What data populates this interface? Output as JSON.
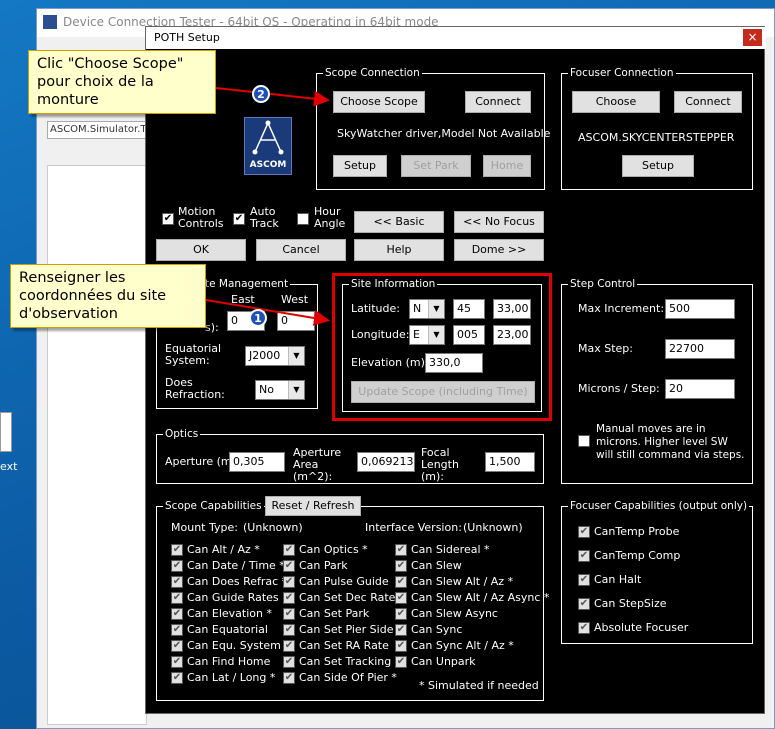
{
  "bg": {
    "title": "Device Connection Tester - 64bit OS - Operating in 64bit mode",
    "field": "ASCOM.Simulator.Telescope",
    "file_label": "ext"
  },
  "dialog": {
    "title": "POTH Setup",
    "close": "×"
  },
  "scope_connection": {
    "legend": "Scope Connection",
    "choose": "Choose Scope",
    "connect": "Connect",
    "status": "SkyWatcher driver,Model Not Available",
    "setup": "Setup",
    "set_park": "Set Park",
    "home": "Home"
  },
  "ascom_logo": "ASCOM",
  "focuser_connection": {
    "legend": "Focuser Connection",
    "choose": "Choose Focuser",
    "connect": "Connect",
    "name": "ASCOM.SKYCENTERSTEPPER",
    "setup": "Setup"
  },
  "options": {
    "motion_controls": "Motion Controls",
    "auto_track": "Auto Track",
    "hour_angle": "Hour Angle",
    "basic": "<< Basic",
    "no_focus": "<< No Focus",
    "ok": "OK",
    "cancel": "Cancel",
    "help": "Help",
    "dome": "Dome >>"
  },
  "coord_mgmt": {
    "legend": "te Management",
    "east": "East",
    "west": "West",
    "sub": "s):",
    "east_val": "0",
    "west_val": "0",
    "equatorial_label": "Equatorial System:",
    "equatorial_val": "J2000",
    "refraction_label": "Does Refraction:",
    "refraction_val": "No"
  },
  "site": {
    "legend": "Site Information",
    "lat_label": "Latitude:",
    "lat_dir": "N",
    "lat_deg": "45",
    "lat_min": "33,00",
    "lon_label": "Longitude:",
    "lon_dir": "E",
    "lon_deg": "005",
    "lon_min": "23,00",
    "elev_label": "Elevation (m):",
    "elev_val": "330,0",
    "update": "Update Scope (including Time)"
  },
  "step": {
    "legend": "Step Control",
    "max_inc_label": "Max Increment:",
    "max_inc": "500",
    "max_step_label": "Max Step:",
    "max_step": "22700",
    "microns_label": "Microns / Step:",
    "microns": "20",
    "note": "Manual moves are in microns. Higher level SW will still command via steps."
  },
  "optics": {
    "legend": "Optics",
    "aperture_label": "Aperture (m):",
    "aperture": "0,305",
    "area_label": "Aperture Area (m^2):",
    "area": "0,069213",
    "focal_label": "Focal Length (m):",
    "focal": "1,500"
  },
  "scope_caps": {
    "legend": "Scope Capabilities",
    "reset": "Reset / Refresh",
    "mount_type": "Mount Type:",
    "mount_val": "(Unknown)",
    "iface": "Interface Version:",
    "iface_val": "(Unknown)",
    "col1": [
      "Can Alt / Az *",
      "Can Date / Time *",
      "Can Does Refrac *",
      "Can Guide Rates",
      "Can Elevation *",
      "Can Equatorial",
      "Can Equ. System *",
      "Can Find Home",
      "Can Lat / Long *"
    ],
    "col2": [
      "Can Optics *",
      "Can Park",
      "Can Pulse Guide",
      "Can Set Dec Rate",
      "Can Set Park",
      "Can Set Pier Side",
      "Can Set RA Rate",
      "Can Set Tracking",
      "Can Side Of Pier *"
    ],
    "col3": [
      "Can Sidereal *",
      "Can Slew",
      "Can Slew Alt / Az *",
      "Can Slew Alt / Az Async *",
      "Can Slew Async",
      "Can Sync",
      "Can Sync Alt / Az *",
      "Can Unpark"
    ],
    "footnote": "* Simulated if needed"
  },
  "focuser_caps": {
    "legend": "Focuser Capabilities (output only)",
    "items": [
      "CanTemp Probe",
      "CanTemp Comp",
      "Can Halt",
      "Can StepSize",
      "Absolute Focuser"
    ]
  },
  "annotations": {
    "callout1": "Clic \"Choose Scope\" pour choix de la monture",
    "callout2": "Renseigner les coordonnées du site d'observation",
    "badge1": "1",
    "badge2": "2"
  },
  "colors": {
    "callout_bg": "#ffffcc",
    "arrow": "#e00000",
    "badge": "#1f4fb8"
  }
}
